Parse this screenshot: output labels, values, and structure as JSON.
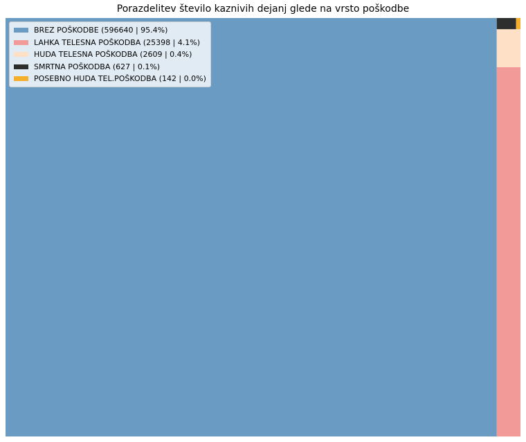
{
  "chart_data": {
    "type": "treemap",
    "title": "Porazdelitev število kaznivih dejanj glede na vrsto poškodbe",
    "legend_position": "top-left",
    "series": [
      {
        "name": "BREZ POŠKODBE",
        "value": 596640,
        "percent": "95.4%",
        "color": "#6a9bc3",
        "label": "BREZ POŠKODBE (596640 | 95.4%)"
      },
      {
        "name": "LAHKA TELESNA POŠKODBA",
        "value": 25398,
        "percent": "4.1%",
        "color": "#f29a98",
        "label": "LAHKA TELESNA POŠKODBA (25398 | 4.1%)"
      },
      {
        "name": "HUDA TELESNA POŠKODBA",
        "value": 2609,
        "percent": "0.4%",
        "color": "#fde0c5",
        "label": "HUDA TELESNA POŠKODBA (2609 | 0.4%)"
      },
      {
        "name": "SMRTNA POŠKODBA",
        "value": 627,
        "percent": "0.1%",
        "color": "#2d2e2e",
        "label": "SMRTNA POŠKODBA (627 | 0.1%)"
      },
      {
        "name": "POSEBNO HUDA TEL.POŠKODBA",
        "value": 142,
        "percent": "0.0%",
        "color": "#f6ae2d",
        "label": "POSEBNO HUDA TEL.POŠKODBA (142 | 0.0%)"
      }
    ]
  }
}
